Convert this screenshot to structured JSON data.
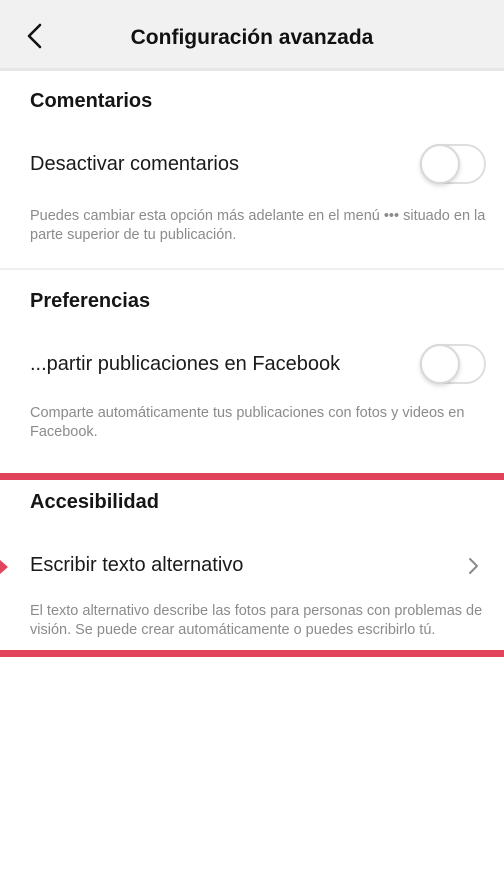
{
  "header": {
    "title": "Configuración avanzada",
    "back_icon": "chevron-left-icon"
  },
  "comentarios": {
    "section_title": "Comentarios",
    "toggle_label": "Desactivar comentarios",
    "toggle_on": false,
    "description": "Puedes cambiar esta opción más adelante en el menú ••• situado en la parte superior de tu publicación."
  },
  "preferencias": {
    "section_title": "Preferencias",
    "toggle_label": "...partir publicaciones en Facebook",
    "toggle_on": false,
    "description": "Comparte automáticamente tus publicaciones con fotos y videos en Facebook."
  },
  "accesibilidad": {
    "section_title": "Accesibilidad",
    "row_label": "Escribir texto alternativo",
    "row_icon": "chevron-right-icon",
    "description": "El texto alternativo describe las fotos para personas con problemas de visión. Se puede crear automáticamente o puedes escribirlo tú."
  },
  "colors": {
    "highlight": "#e0435a",
    "description_text": "#8b8b8b"
  }
}
